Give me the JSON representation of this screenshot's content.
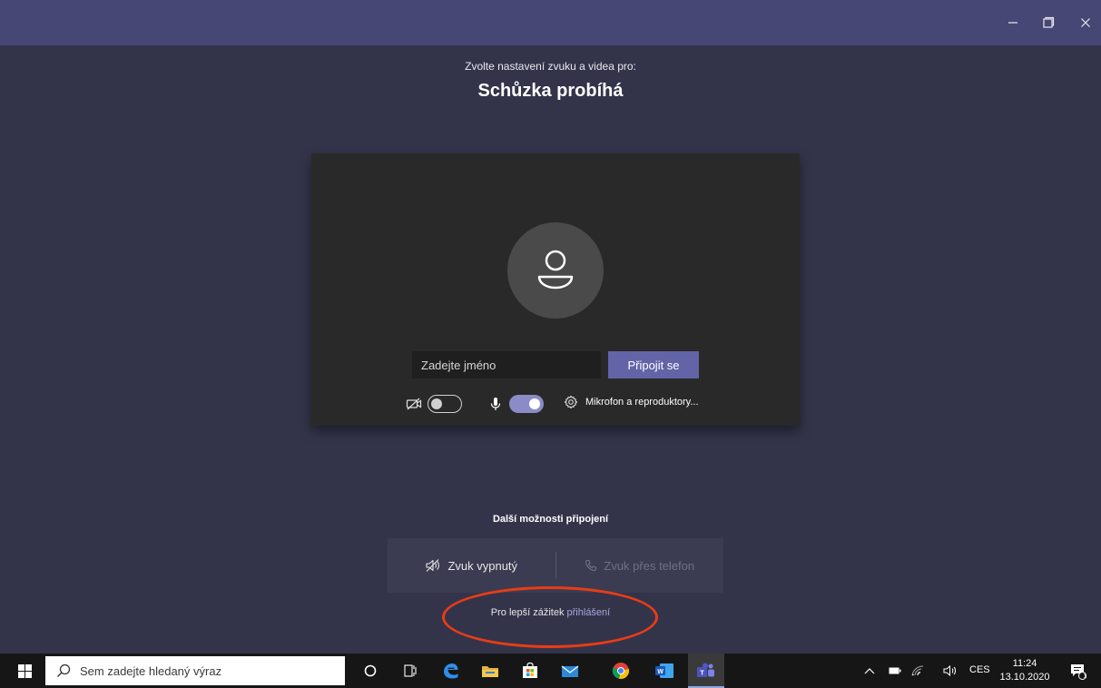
{
  "window": {
    "minimize_label": "–",
    "restore_label": "❐",
    "close_label": "✕"
  },
  "prejoin": {
    "subtitle": "Zvolte nastavení zvuku a videa pro:",
    "meeting_title": "Schůzka probíhá",
    "name_placeholder": "Zadejte jméno",
    "join_label": "Připojit se",
    "camera_on": false,
    "mic_on": true,
    "device_settings_label": "Mikrofon a reproduktory..."
  },
  "other_options": {
    "title": "Další možnosti připojení",
    "audio_off_label": "Zvuk vypnutý",
    "phone_audio_label": "Zvuk přes telefon",
    "signin_prefix": "Pro lepší zážitek",
    "signin_link": "přihlášení"
  },
  "taskbar": {
    "search_placeholder": "Sem zadejte hledaný výraz",
    "language": "CES",
    "time": "11:24",
    "date": "13.10.2020",
    "notification_count": "1",
    "apps": [
      "cortana-icon",
      "task-view-icon",
      "edge-icon",
      "file-explorer-icon",
      "store-icon",
      "mail-icon",
      "chrome-icon",
      "word-icon",
      "teams-icon"
    ]
  },
  "colors": {
    "titlebar": "#464775",
    "background": "#33344a",
    "accent": "#6264a7",
    "highlight_ellipse": "#ea3c14"
  }
}
